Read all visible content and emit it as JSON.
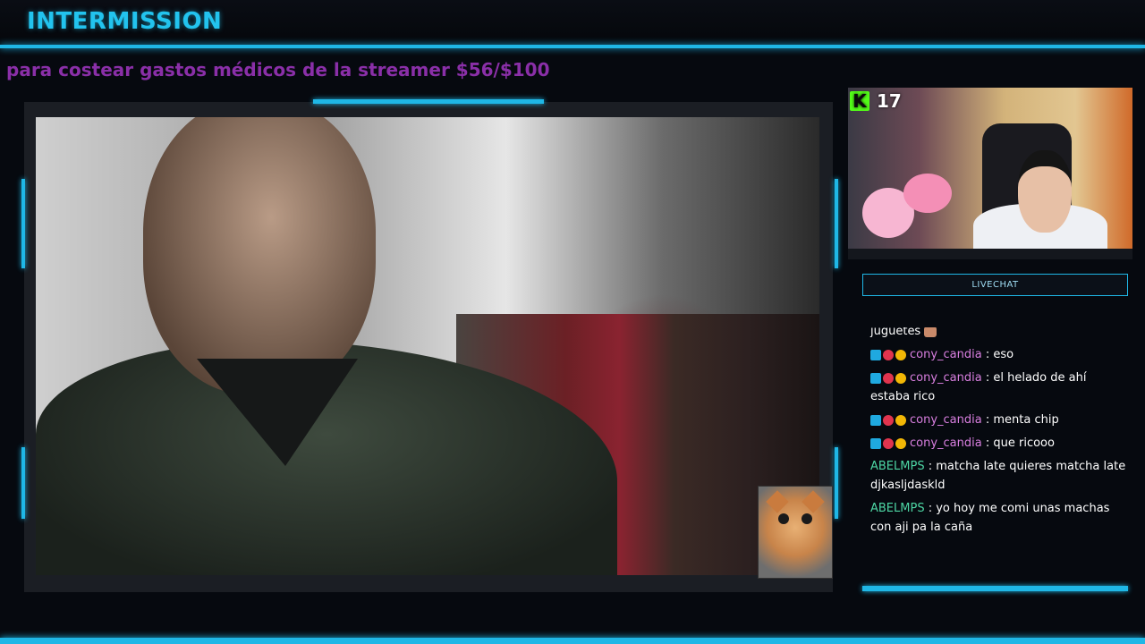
{
  "header": {
    "title": "INTERMISSION"
  },
  "goal": {
    "text": "para costear gastos médicos de la streamer",
    "amount": "$56/$100"
  },
  "webcam": {
    "platform_icon": "kick-k-icon",
    "platform_glyph": "K",
    "viewer_count": "17"
  },
  "chat": {
    "header_label": "LIVECHAT",
    "messages": [
      {
        "user": "",
        "text": "juguetes",
        "partial": true,
        "badges": []
      },
      {
        "user": "cony_candia",
        "text": ": eso",
        "color": "#d97fe0",
        "badges": [
          "prime-icon",
          "heart-icon",
          "gift-icon"
        ]
      },
      {
        "user": "cony_candia",
        "text": ": el helado de ahí estaba rico",
        "color": "#d97fe0",
        "badges": [
          "prime-icon",
          "heart-icon",
          "gift-icon"
        ]
      },
      {
        "user": "cony_candia",
        "text": ": menta chip",
        "color": "#d97fe0",
        "badges": [
          "prime-icon",
          "heart-icon",
          "gift-icon"
        ]
      },
      {
        "user": "cony_candia",
        "text": ": que ricooo",
        "color": "#d97fe0",
        "badges": [
          "prime-icon",
          "heart-icon",
          "gift-icon"
        ]
      },
      {
        "user": "ABELMPS",
        "text": ": matcha late quieres matcha late djkasljdaskld",
        "color": "#4dd6a4",
        "badges": []
      },
      {
        "user": "ABELMPS",
        "text": ": yo hoy me comi unas machas con aji pa la caña",
        "color": "#4dd6a4",
        "badges": []
      }
    ]
  },
  "colors": {
    "accent": "#1fb7e6",
    "goal_text": "#8a2fa8",
    "title": "#22c3ee",
    "kick_green": "#53fc18"
  }
}
